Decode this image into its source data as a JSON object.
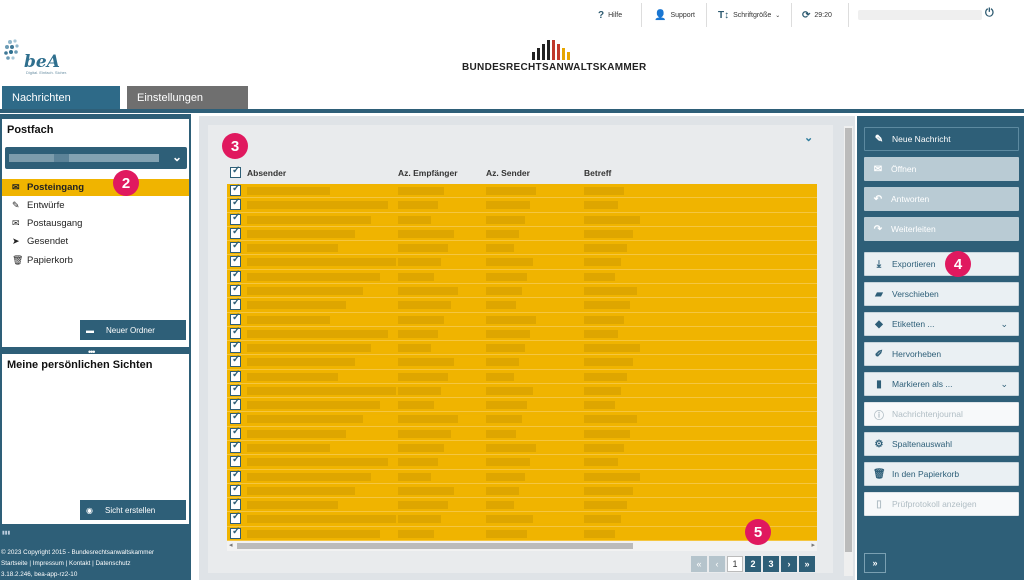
{
  "topbar": {
    "help_label": "Hilfe",
    "support_label": "Support",
    "fontsize_label": "Schriftgröße",
    "timer_label": "29:20"
  },
  "header": {
    "logo_text": "beA",
    "logo_tagline": "Digital. Einfach. Sicher.",
    "org_name": "BUNDESRECHTSANWALTSKAMMER"
  },
  "nav": {
    "tabs": [
      {
        "label": "Nachrichten",
        "active": true
      },
      {
        "label": "Einstellungen",
        "active": false
      }
    ]
  },
  "sidebar": {
    "postfach_title": "Postfach",
    "folders": [
      {
        "label": "Posteingang",
        "icon": "inbox-icon",
        "selected": true
      },
      {
        "label": "Entwürfe",
        "icon": "edit-icon",
        "selected": false
      },
      {
        "label": "Postausgang",
        "icon": "envelope-open-icon",
        "selected": false
      },
      {
        "label": "Gesendet",
        "icon": "send-icon",
        "selected": false
      },
      {
        "label": "Papierkorb",
        "icon": "trash-icon",
        "selected": false
      }
    ],
    "new_folder_label": "Neuer Ordner",
    "views_title": "Meine persönlichen Sichten",
    "create_view_label": "Sicht erstellen",
    "footer": {
      "copyright": "© 2023 Copyright 2015 - Bundesrechtsanwaltskammer",
      "links": "Startseite | Impressum | Kontakt | Datenschutz",
      "version": "3.18.2.246, bea-app-rz2-10"
    }
  },
  "table": {
    "headers": {
      "sender": "Absender",
      "az_recipient": "Az. Empfänger",
      "az_sender": "Az. Sender",
      "subject": "Betreff"
    },
    "row_count": 25,
    "rows_selected": true
  },
  "badges": [
    "2",
    "3",
    "4",
    "5"
  ],
  "pagination": {
    "first": "«",
    "prev": "‹",
    "pages": [
      "1",
      "2",
      "3"
    ],
    "current_page": "1",
    "next": "›",
    "last": "»"
  },
  "actions": [
    {
      "label": "Neue Nachricht",
      "icon": "pencil-icon",
      "state": "primary"
    },
    {
      "label": "Öffnen",
      "icon": "envelope-icon",
      "state": "disabled"
    },
    {
      "label": "Antworten",
      "icon": "reply-icon",
      "state": "disabled"
    },
    {
      "label": "Weiterleiten",
      "icon": "forward-icon",
      "state": "disabled"
    },
    {
      "label": "Exportieren",
      "icon": "download-icon",
      "state": "normal"
    },
    {
      "label": "Verschieben",
      "icon": "folder-open-icon",
      "state": "normal"
    },
    {
      "label": "Etiketten ...",
      "icon": "tags-icon",
      "state": "normal",
      "dropdown": true
    },
    {
      "label": "Hervorheben",
      "icon": "highlighter-icon",
      "state": "normal"
    },
    {
      "label": "Markieren als ...",
      "icon": "bookmark-icon",
      "state": "normal",
      "dropdown": true
    },
    {
      "label": "Nachrichtenjournal",
      "icon": "info-icon",
      "state": "light"
    },
    {
      "label": "Spaltenauswahl",
      "icon": "cog-icon",
      "state": "normal"
    },
    {
      "label": "In den Papierkorb",
      "icon": "trash-icon",
      "state": "normal"
    },
    {
      "label": "Prüfprotokoll anzeigen",
      "icon": "file-icon",
      "state": "light"
    }
  ],
  "colors": {
    "primary": "#2e5f78",
    "selection": "#f0b400",
    "badge": "#e0195f"
  }
}
